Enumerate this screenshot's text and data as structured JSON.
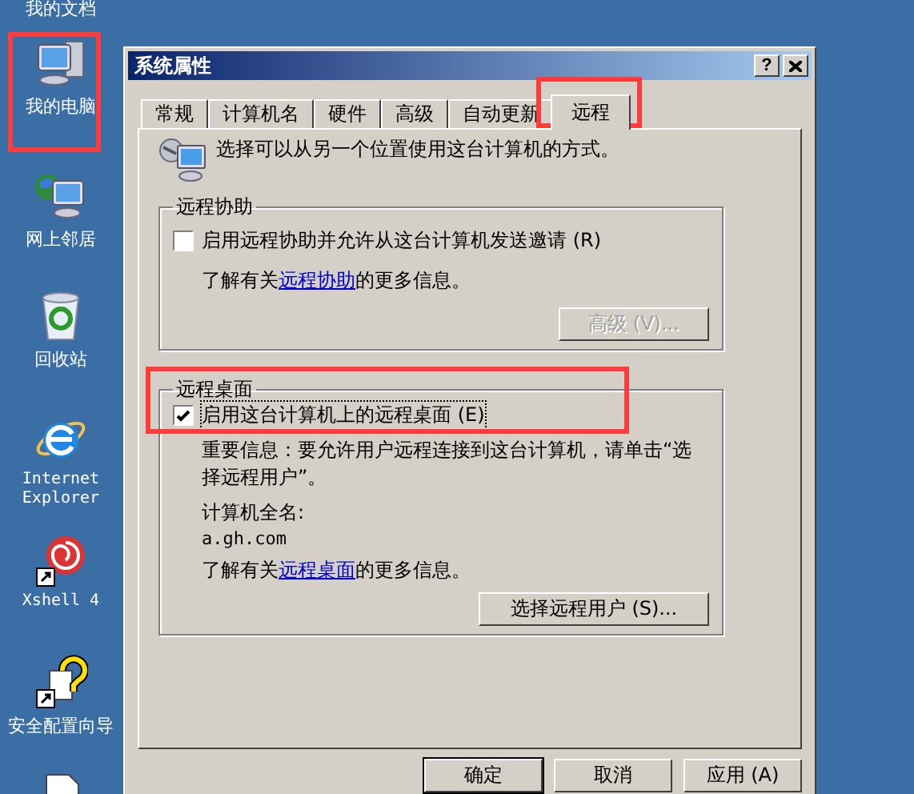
{
  "desktop": {
    "icons": [
      {
        "kind": "documents",
        "label": "我的文档"
      },
      {
        "kind": "computer",
        "label": "我的电脑"
      },
      {
        "kind": "network",
        "label": "网上邻居"
      },
      {
        "kind": "recycle",
        "label": "回收站"
      },
      {
        "kind": "browser",
        "label": "Internet Explorer"
      },
      {
        "kind": "shell",
        "label": "Xshell 4"
      },
      {
        "kind": "wizard",
        "label": "安全配置向导"
      },
      {
        "kind": "file"
      }
    ]
  },
  "window": {
    "title": "系统属性",
    "help": "?"
  },
  "tabs": [
    {
      "label": "常规",
      "selected": false
    },
    {
      "label": "计算机名",
      "selected": false
    },
    {
      "label": "硬件",
      "selected": false
    },
    {
      "label": "高级",
      "selected": false
    },
    {
      "label": "自动更新",
      "selected": false
    },
    {
      "label": "远程",
      "selected": true
    }
  ],
  "intro": "选择可以从另一个位置使用这台计算机的方式。",
  "remote_assistance": {
    "title": "远程协助",
    "checkbox": {
      "label": "启用远程协助并允许从这台计算机发送邀请 (R)",
      "checked": false
    },
    "info_prefix": "了解有关",
    "info_link": "远程协助",
    "info_suffix": "的更多信息。",
    "advanced_button": {
      "label": "高级 (V)...",
      "disabled": true
    }
  },
  "remote_desktop": {
    "title": "远程桌面",
    "checkbox": {
      "label": "启用这台计算机上的远程桌面 (E)",
      "checked": true
    },
    "note": "重要信息：要允许用户远程连接到这台计算机，请单击“选择远程用户”。",
    "computer_name_label": "计算机全名:",
    "computer_name": "a.gh.com",
    "info_prefix": "了解有关",
    "info_link": "远程桌面",
    "info_suffix": "的更多信息。",
    "select_users_button": {
      "label": "选择远程用户 (S)...",
      "disabled": false
    }
  },
  "buttons": [
    {
      "label": "确定",
      "default": true
    },
    {
      "label": "取消",
      "default": false
    },
    {
      "label": "应用 (A)",
      "default": false
    }
  ]
}
